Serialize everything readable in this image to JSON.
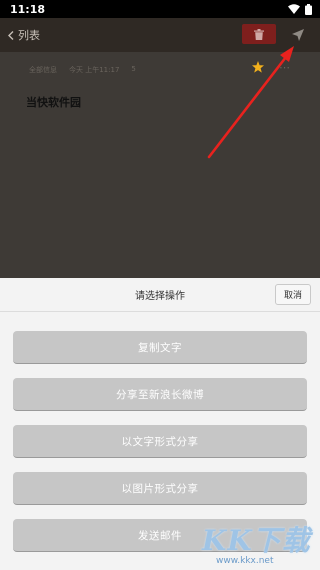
{
  "status_bar": {
    "time": "11:18"
  },
  "toolbar": {
    "back_label": "列表"
  },
  "message": {
    "sender": "全部信息",
    "time": "今天 上午11:17",
    "extra": "5",
    "title": "当快软件园"
  },
  "sheet": {
    "title": "请选择操作",
    "cancel_label": "取消",
    "actions": [
      {
        "label": "复制文字"
      },
      {
        "label": "分享至新浪长微博"
      },
      {
        "label": "以文字形式分享"
      },
      {
        "label": "以图片形式分享"
      },
      {
        "label": "发送邮件"
      }
    ]
  },
  "watermark": {
    "text": "KK下载",
    "url": "www.kkx.net"
  },
  "colors": {
    "toolbar": "#2f2924",
    "delete": "#7e1f1d",
    "action_button": "#c6c6c6",
    "arrow": "#e8221e",
    "star": "#f2b01c"
  }
}
